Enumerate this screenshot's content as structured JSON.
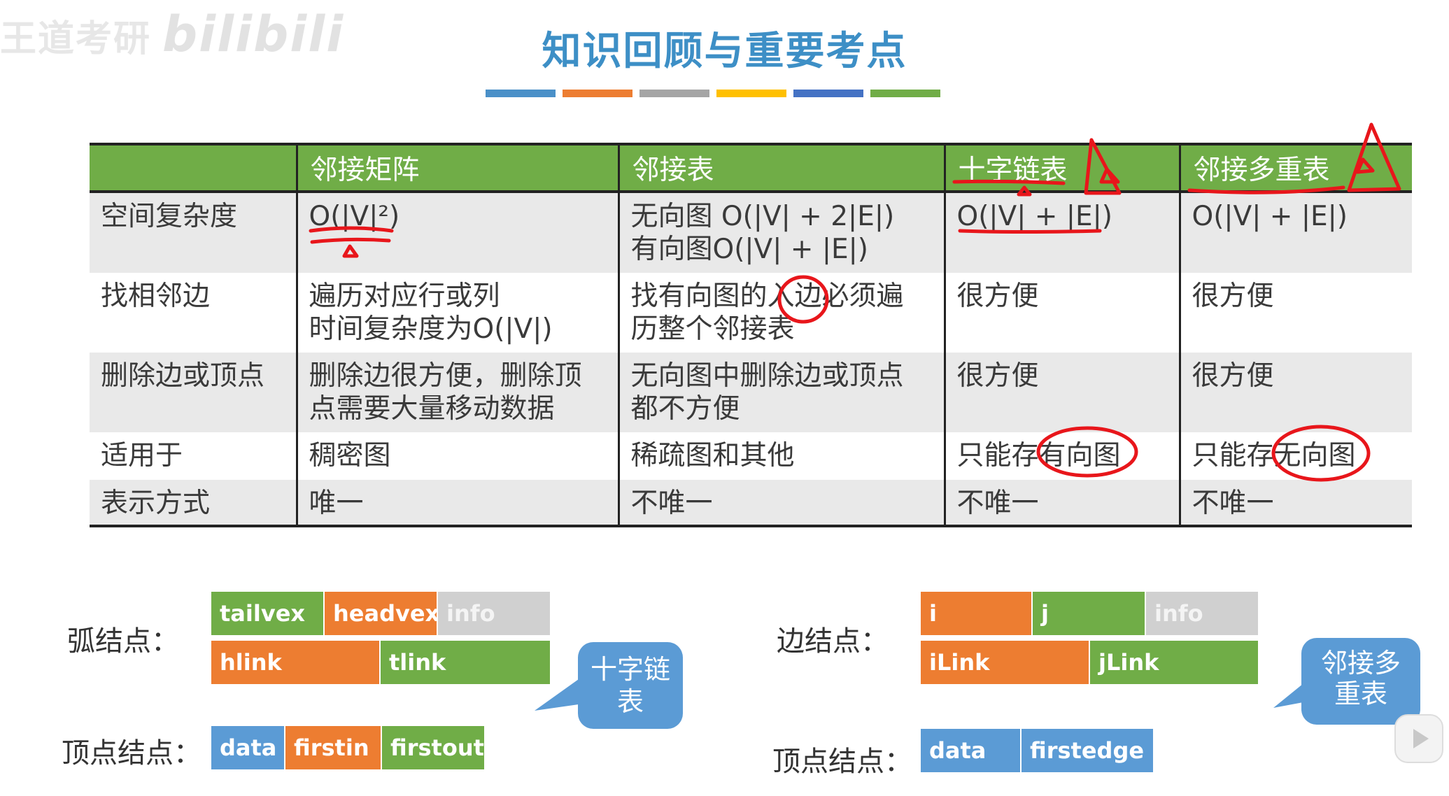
{
  "watermark": {
    "text": "王道考研",
    "brand": "bilibili"
  },
  "title": "知识回顾与重要考点",
  "accent_bars": [
    "#4a90c8",
    "#ed7d31",
    "#a5a5a5",
    "#ffc000",
    "#4472c4",
    "#70ad47"
  ],
  "table": {
    "headers": [
      "",
      "邻接矩阵",
      "邻接表",
      "十字链表",
      "邻接多重表"
    ],
    "rows": [
      {
        "label": "空间复杂度",
        "cells": [
          {
            "l1": "O(|V|²)",
            "l2": ""
          },
          {
            "l1": "无向图 O(|V| + 2|E|)",
            "l2": "有向图O(|V| + |E|)"
          },
          {
            "l1": "O(|V| + |E|)",
            "l2": ""
          },
          {
            "l1": "O(|V| + |E|)",
            "l2": ""
          }
        ]
      },
      {
        "label": "找相邻边",
        "cells": [
          {
            "l1": "遍历对应行或列",
            "l2": "时间复杂度为O(|V|)"
          },
          {
            "l1": "找有向图的入边必须遍",
            "l2": "历整个邻接表"
          },
          {
            "l1": "很方便",
            "l2": ""
          },
          {
            "l1": "很方便",
            "l2": ""
          }
        ]
      },
      {
        "label": "删除边或顶点",
        "cells": [
          {
            "l1": "删除边很方便，删除顶",
            "l2": "点需要大量移动数据"
          },
          {
            "l1": "无向图中删除边或顶点",
            "l2": "都不方便"
          },
          {
            "l1": "很方便",
            "l2": ""
          },
          {
            "l1": "很方便",
            "l2": ""
          }
        ]
      },
      {
        "label": "适用于",
        "cells": [
          {
            "l1": "稠密图",
            "l2": ""
          },
          {
            "l1": "稀疏图和其他",
            "l2": ""
          },
          {
            "l1": "只能存有向图",
            "l2": ""
          },
          {
            "l1": "只能存无向图",
            "l2": ""
          }
        ]
      },
      {
        "label": "表示方式",
        "cells": [
          {
            "l1": "唯一",
            "l2": ""
          },
          {
            "l1": "不唯一",
            "l2": ""
          },
          {
            "l1": "不唯一",
            "l2": ""
          },
          {
            "l1": "不唯一",
            "l2": ""
          }
        ]
      }
    ]
  },
  "orthogonal": {
    "arc_label": "弧结点：",
    "arc_row1": [
      "tailvex",
      "headvex",
      "info"
    ],
    "arc_row2": [
      "hlink",
      "tlink"
    ],
    "vertex_label": "顶点结点：",
    "vertex_fields": [
      "data",
      "firstin",
      "firstout"
    ],
    "bubble": "十字链表"
  },
  "multilist": {
    "edge_label": "边结点：",
    "edge_row1": [
      "i",
      "j",
      "info"
    ],
    "edge_row2": [
      "iLink",
      "jLink"
    ],
    "vertex_label": "顶点结点：",
    "vertex_fields": [
      "data",
      "firstedge"
    ],
    "bubble": "邻接多重表"
  },
  "annotation_color": "#e8161b"
}
